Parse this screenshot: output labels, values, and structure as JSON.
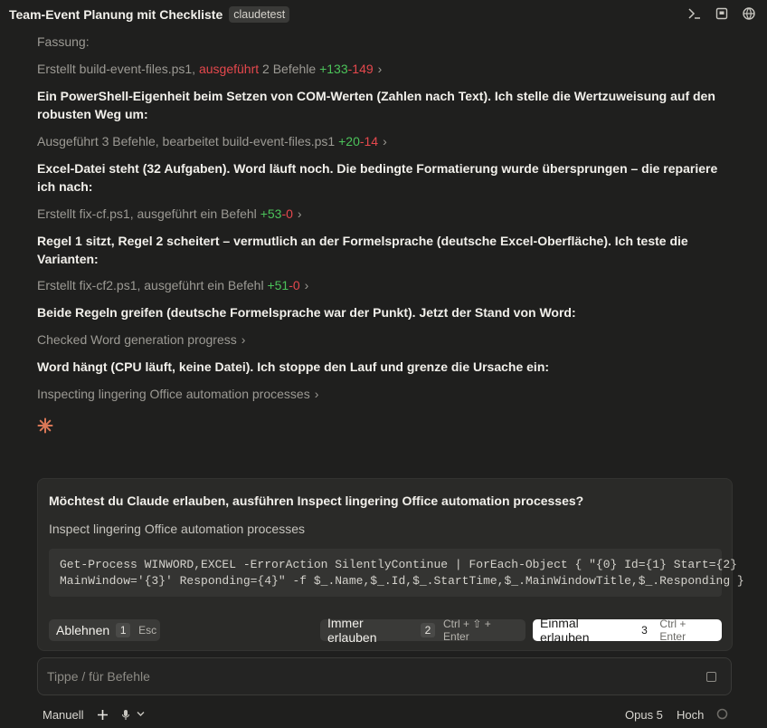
{
  "window": {
    "title": "Team-Event Planung mit Checkliste",
    "project_badge": "claudetest"
  },
  "transcript": {
    "top_partial": "Fassung:",
    "step1": {
      "prefix": "Erstellt build-event-files.ps1, ",
      "highlight": "ausgeführt",
      "suffix": " 2 Befehle ",
      "added": "+133",
      "removed": "-149"
    },
    "msg1": "Ein PowerShell-Eigenheit beim Setzen von COM-Werten (Zahlen nach Text). Ich stelle die Wertzuweisung auf den robusten Weg um:",
    "step2": {
      "text": "Ausgeführt 3 Befehle, bearbeitet build-event-files.ps1 ",
      "added": "+20",
      "removed": "-14"
    },
    "msg2": "Excel-Datei steht (32 Aufgaben). Word läuft noch. Die bedingte Formatierung wurde übersprungen – die repariere ich nach:",
    "step3": {
      "text": "Erstellt fix-cf.ps1, ausgeführt ein Befehl ",
      "added": "+53",
      "removed": "-0"
    },
    "msg3": "Regel 1 sitzt, Regel 2 scheitert – vermutlich an der Formelsprache (deutsche Excel-Oberfläche). Ich teste die Varianten:",
    "step4": {
      "text": "Erstellt fix-cf2.ps1, ausgeführt ein Befehl ",
      "added": "+51",
      "removed": "-0"
    },
    "msg4": "Beide Regeln greifen (deutsche Formelsprache war der Punkt). Jetzt der Stand von Word:",
    "step5": {
      "text": "Checked Word generation progress"
    },
    "msg5": "Word hängt (CPU läuft, keine Datei). Ich stoppe den Lauf und grenze die Ursache ein:",
    "step6": {
      "text": "Inspecting lingering Office automation processes"
    }
  },
  "permission": {
    "question": "Möchtest du Claude erlauben, ausführen Inspect lingering Office automation processes?",
    "subtitle": "Inspect lingering Office automation processes",
    "code_line1": "Get-Process WINWORD,EXCEL -ErrorAction SilentlyContinue | ForEach-Object { \"{0} Id={1} Start={2}",
    "code_line2": "MainWindow='{3}' Responding={4}\" -f $_.Name,$_.Id,$_.StartTime,$_.MainWindowTitle,$_.Responding }",
    "deny": {
      "label": "Ablehnen",
      "key": "1",
      "hint": "Esc"
    },
    "always": {
      "label": "Immer erlauben",
      "key": "2",
      "hint": "Ctrl + ⇧ + Enter"
    },
    "once": {
      "label": "Einmal erlauben",
      "key": "3",
      "hint": "Ctrl + Enter"
    }
  },
  "input": {
    "placeholder": "Tippe / für Befehle"
  },
  "footer": {
    "mode": "Manuell",
    "model": "Opus 5",
    "effort": "Hoch"
  },
  "colors": {
    "accent": "#d97757",
    "added": "#4cc35a",
    "removed": "#e5484d"
  },
  "icons": [
    "terminal-icon",
    "preview-icon",
    "globe-icon",
    "chevron-right-icon",
    "claude-spark-icon",
    "plus-icon",
    "microphone-icon",
    "chevron-down-icon",
    "stop-square-icon",
    "status-circle-icon"
  ]
}
